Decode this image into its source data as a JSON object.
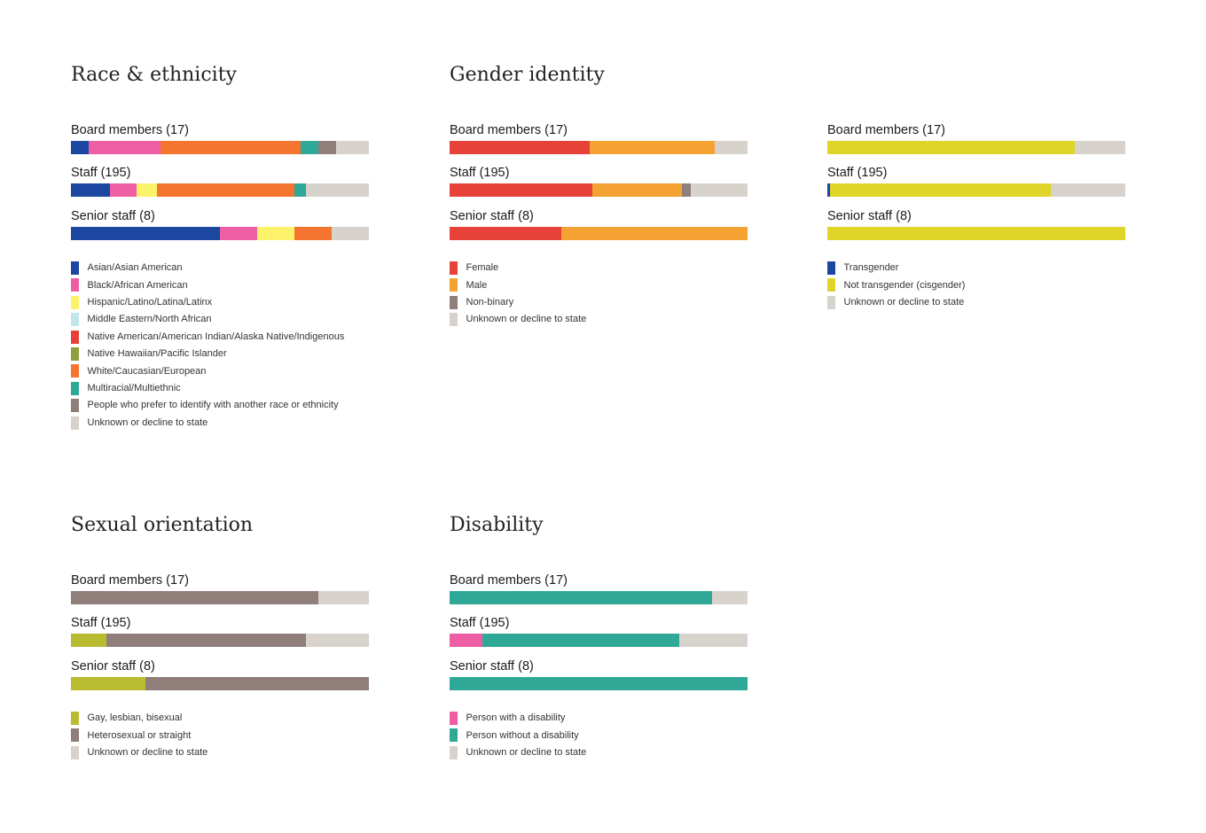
{
  "chart_data": [
    {
      "type": "bar",
      "stacked": true,
      "orientation": "horizontal",
      "title": "Race & ethnicity",
      "xlim": [
        0,
        100
      ],
      "grid": false,
      "legend_position": "bottom",
      "categories": [
        "Board members (17)",
        "Staff (195)",
        "Senior staff (8)"
      ],
      "series": [
        {
          "name": "Asian/Asian American",
          "color": "#1b47a0",
          "values": [
            6,
            13,
            50
          ]
        },
        {
          "name": "Black/African American",
          "color": "#ee5ea4",
          "values": [
            24,
            9,
            12.5
          ]
        },
        {
          "name": "Hispanic/Latino/Latina/Latinx",
          "color": "#fdf36a",
          "values": [
            0,
            7,
            12.5
          ]
        },
        {
          "name": "Middle Eastern/North African",
          "color": "#c3e6ec",
          "values": [
            0,
            0,
            0
          ]
        },
        {
          "name": "Native American/American Indian/Alaska Native/Indigenous",
          "color": "#e7423a",
          "values": [
            0,
            0,
            0
          ]
        },
        {
          "name": "Native Hawaiian/Pacific Islander",
          "color": "#8fa03e",
          "values": [
            0,
            0,
            0
          ]
        },
        {
          "name": "White/Caucasian/European",
          "color": "#f47430",
          "values": [
            47,
            46,
            12.5
          ]
        },
        {
          "name": "Multiracial/Multiethnic",
          "color": "#2fa897",
          "values": [
            6,
            4,
            0
          ]
        },
        {
          "name": "People who prefer to identify with another race or ethnicity",
          "color": "#8f7e7a",
          "values": [
            6,
            0,
            0
          ]
        },
        {
          "name": "Unknown or decline to state",
          "color": "#d8d2cd",
          "values": [
            11,
            21,
            12.5
          ]
        }
      ]
    },
    {
      "type": "bar",
      "stacked": true,
      "orientation": "horizontal",
      "title": "Gender identity",
      "xlim": [
        0,
        100
      ],
      "grid": false,
      "legend_position": "bottom",
      "categories": [
        "Board members (17)",
        "Staff (195)",
        "Senior staff (8)"
      ],
      "series": [
        {
          "name": "Female",
          "color": "#e7423a",
          "values": [
            47,
            48,
            37.5
          ]
        },
        {
          "name": "Male",
          "color": "#f4a232",
          "values": [
            42,
            30,
            62.5
          ]
        },
        {
          "name": "Non-binary",
          "color": "#8f7e7a",
          "values": [
            0,
            3,
            0
          ]
        },
        {
          "name": "Unknown or decline to state",
          "color": "#d8d2cd",
          "values": [
            11,
            19,
            0
          ]
        }
      ]
    },
    {
      "type": "bar",
      "stacked": true,
      "orientation": "horizontal",
      "title": "",
      "xlim": [
        0,
        100
      ],
      "grid": false,
      "legend_position": "bottom",
      "categories": [
        "Board members (17)",
        "Staff (195)",
        "Senior staff (8)"
      ],
      "series": [
        {
          "name": "Transgender",
          "color": "#1b47a0",
          "values": [
            0,
            1,
            0
          ]
        },
        {
          "name": "Not transgender (cisgender)",
          "color": "#dfd428",
          "values": [
            83,
            74,
            100
          ]
        },
        {
          "name": "Unknown or decline to state",
          "color": "#d8d2cd",
          "values": [
            17,
            25,
            0
          ]
        }
      ]
    },
    {
      "type": "bar",
      "stacked": true,
      "orientation": "horizontal",
      "title": "Sexual orientation",
      "xlim": [
        0,
        100
      ],
      "grid": false,
      "legend_position": "bottom",
      "categories": [
        "Board members (17)",
        "Staff (195)",
        "Senior staff (8)"
      ],
      "series": [
        {
          "name": "Gay, lesbian, bisexual",
          "color": "#b9bb30",
          "values": [
            0,
            12,
            25
          ]
        },
        {
          "name": "Heterosexual or straight",
          "color": "#8f7e7a",
          "values": [
            83,
            67,
            75
          ]
        },
        {
          "name": "Unknown or decline to state",
          "color": "#d8d2cd",
          "values": [
            17,
            21,
            0
          ]
        }
      ]
    },
    {
      "type": "bar",
      "stacked": true,
      "orientation": "horizontal",
      "title": "Disability",
      "xlim": [
        0,
        100
      ],
      "grid": false,
      "legend_position": "bottom",
      "categories": [
        "Board members (17)",
        "Staff (195)",
        "Senior staff (8)"
      ],
      "series": [
        {
          "name": "Person with a disability",
          "color": "#ee5ea4",
          "values": [
            0,
            11,
            0
          ]
        },
        {
          "name": "Person without a disability",
          "color": "#2fa897",
          "values": [
            88,
            66,
            100
          ]
        },
        {
          "name": "Unknown or decline to state",
          "color": "#d8d2cd",
          "values": [
            12,
            23,
            0
          ]
        }
      ]
    }
  ],
  "legend_labels": [
    [
      "Asian/Asian American",
      "Black/African American",
      "Hispanic/Latino/Latina/Latinx",
      "Middle Eastern/North African",
      "Native American/American Indian/Alaska Native/Indigenous",
      "Native Hawaiian/Pacific Islander",
      "White/Caucasian/European",
      "Multiracial/Multiethnic",
      "People who prefer to identify with another race or ethnicity",
      "Unknown or decline to state"
    ],
    [
      "Female",
      "Male",
      "Non-binary",
      "Unknown or decline to state"
    ],
    [
      "Transgender",
      "Not transgender (cisgender)",
      "Unknown or decline to state"
    ],
    [
      "Gay, lesbian, bisexual",
      "Heterosexual or straight",
      "Unknown or decline to state"
    ],
    [
      "Person with a disability",
      "Person without a disability",
      "Unknown or decline to state"
    ]
  ]
}
